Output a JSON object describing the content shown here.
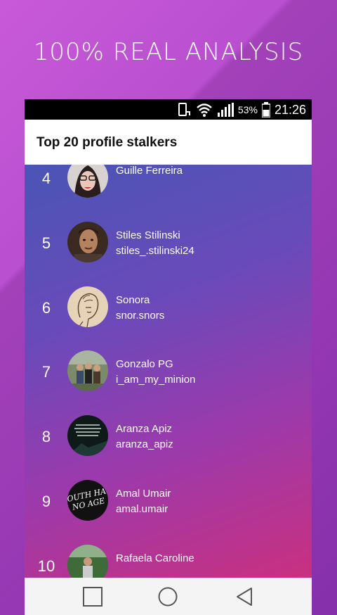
{
  "promo": {
    "headline": "100% REAL ANALYSIS"
  },
  "status_bar": {
    "battery": "53%",
    "time": "21:26"
  },
  "app_bar": {
    "title": "Top 20 profile stalkers"
  },
  "stalkers": [
    {
      "rank": "4",
      "name": "Guille Ferreira",
      "handle": ""
    },
    {
      "rank": "5",
      "name": "Stiles Stilinski",
      "handle": "stiles_.stilinski24"
    },
    {
      "rank": "6",
      "name": "Sonora",
      "handle": "snor.snors"
    },
    {
      "rank": "7",
      "name": "Gonzalo PG",
      "handle": "i_am_my_minion"
    },
    {
      "rank": "8",
      "name": "Aranza Apiz",
      "handle": "aranza_apiz"
    },
    {
      "rank": "9",
      "name": "Amal Umair",
      "handle": "amal.umair"
    },
    {
      "rank": "10",
      "name": "Rafaela Caroline",
      "handle": ""
    }
  ],
  "avatar_texts": {
    "amal": "YOUTH HAS NO AGE"
  },
  "nav": {
    "icons": [
      "recents-square-icon",
      "home-circle-icon",
      "back-triangle-icon"
    ]
  }
}
